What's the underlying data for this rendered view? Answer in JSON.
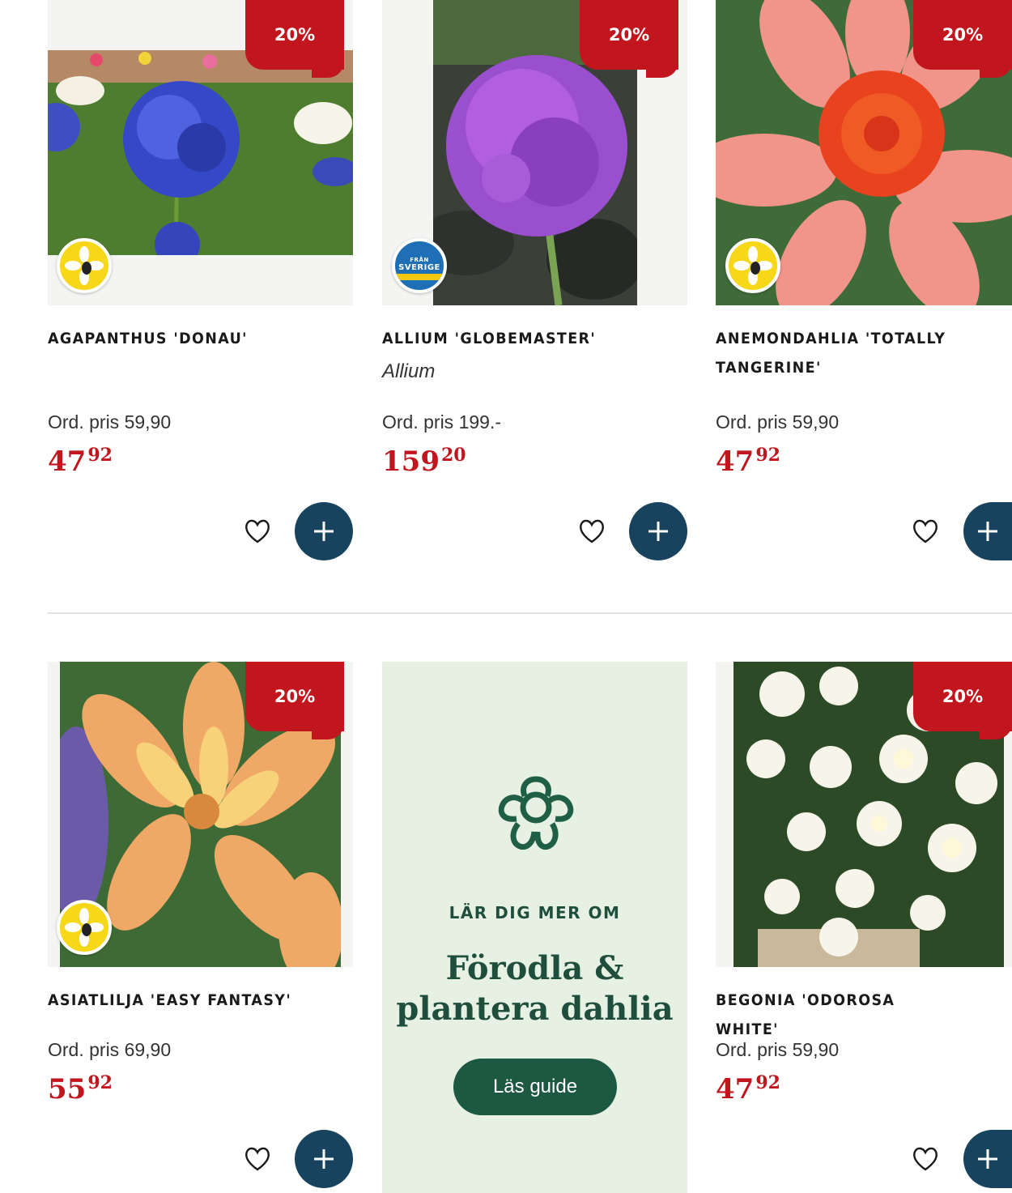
{
  "products": [
    {
      "discount": "20%",
      "badge": "bee-friendly-icon",
      "title": "Agapanthus 'Donau'",
      "subtitle": "",
      "ord_price": "Ord. pris 59,90",
      "price_whole": "47",
      "price_cents": "92"
    },
    {
      "discount": "20%",
      "badge": "fran-sverige-icon",
      "badge_text_top": "FRÅN",
      "badge_text_bottom": "SVERIGE",
      "title": "Allium 'Globemaster'",
      "subtitle": "Allium",
      "ord_price": "Ord. pris 199.-",
      "price_whole": "159",
      "price_cents": "20"
    },
    {
      "discount": "20%",
      "badge": "bee-friendly-icon",
      "title": "Anemondahlia 'Totally Tangerine'",
      "subtitle": "",
      "ord_price": "Ord. pris 59,90",
      "price_whole": "47",
      "price_cents": "92"
    },
    {
      "discount": "20%",
      "badge": "bee-friendly-icon",
      "title": "Asiatlilja 'Easy Fantasy'",
      "subtitle": "",
      "ord_price": "Ord. pris 69,90",
      "price_whole": "55",
      "price_cents": "92"
    },
    {
      "discount": "20%",
      "badge": "",
      "title": "Begonia 'Odorosa White'",
      "subtitle": "",
      "ord_price": "Ord. pris 59,90",
      "price_whole": "47",
      "price_cents": "92"
    }
  ],
  "promo": {
    "icon": "flower-icon",
    "kicker": "LÄR DIG MER OM",
    "heading_line1": "Förodla &",
    "heading_line2": "plantera dahlia",
    "button_label": "Läs guide"
  },
  "colors": {
    "discount_red": "#c2161f",
    "price_red": "#c2161f",
    "cart_button": "#17435e",
    "promo_bg": "#e6f1e4",
    "promo_green": "#1d5842"
  }
}
